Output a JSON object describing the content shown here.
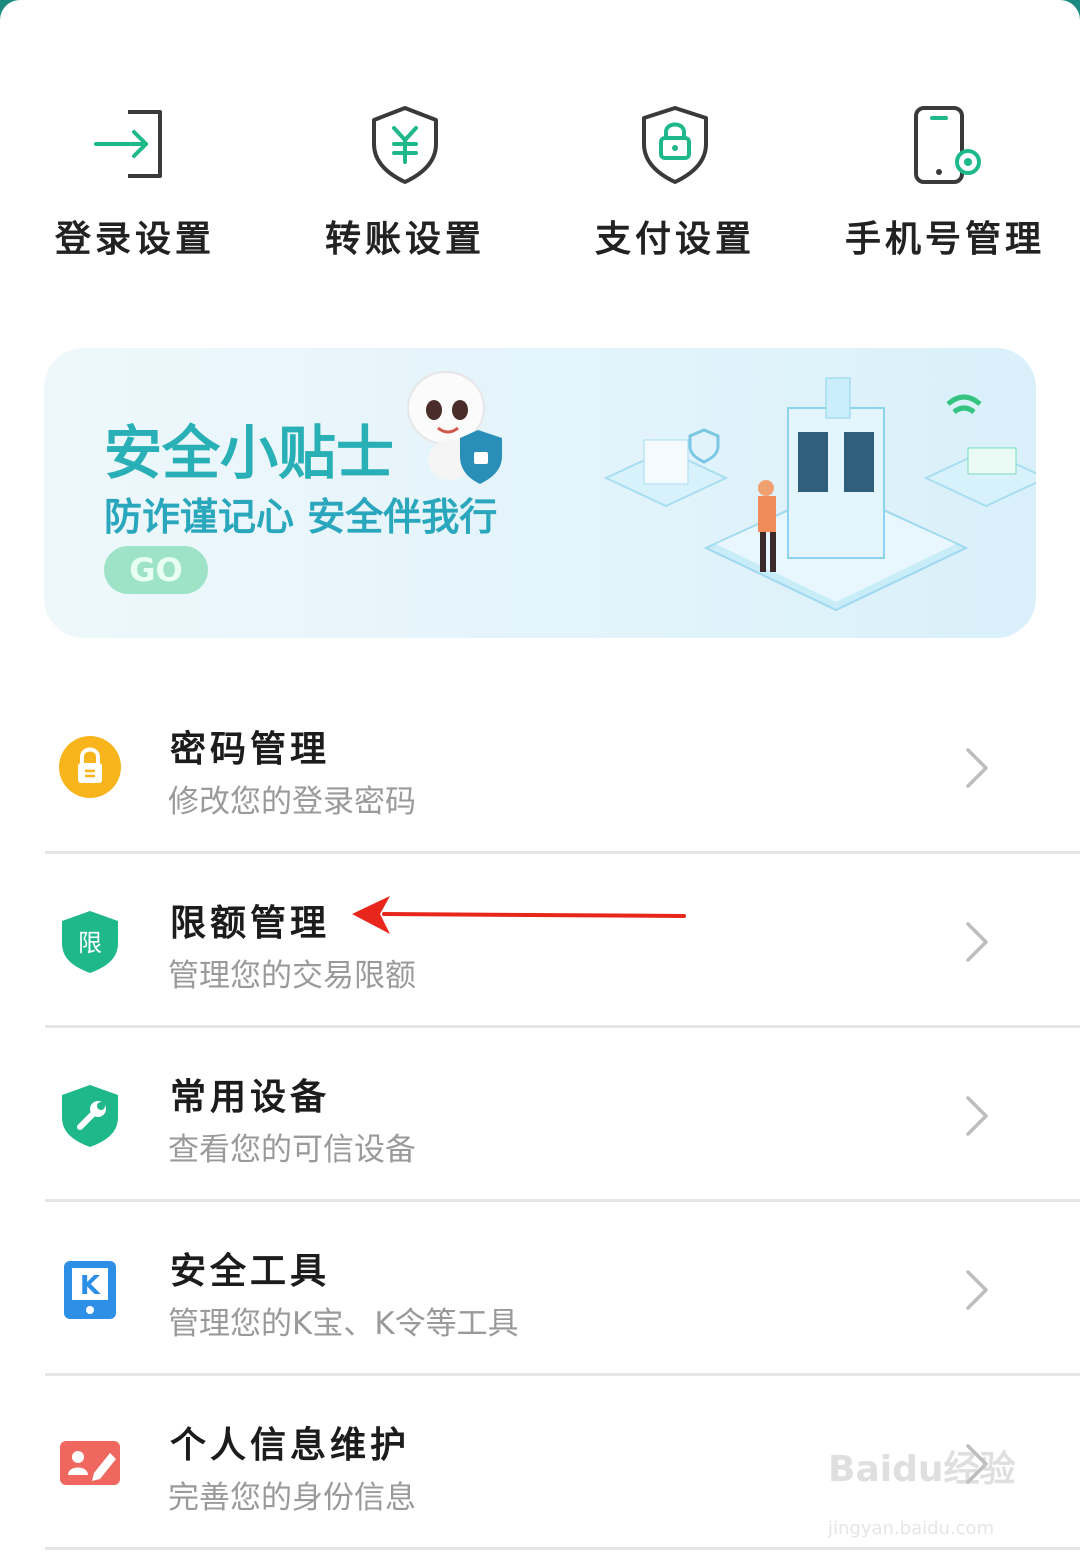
{
  "quick_actions": [
    {
      "label": "登录设置",
      "icon": "login-icon"
    },
    {
      "label": "转账设置",
      "icon": "transfer-shield-icon"
    },
    {
      "label": "支付设置",
      "icon": "payment-lock-icon"
    },
    {
      "label": "手机号管理",
      "icon": "phone-settings-icon"
    }
  ],
  "banner": {
    "title": "安全小贴士",
    "subtitle": "防诈谨记心 安全伴我行",
    "go_label": "GO"
  },
  "menu": [
    {
      "title": "密码管理",
      "subtitle": "修改您的登录密码",
      "icon": "lock-icon",
      "color": "#f7b51b"
    },
    {
      "title": "限额管理",
      "subtitle": "管理您的交易限额",
      "icon": "limit-shield-icon",
      "color": "#1fb88a",
      "icon_text": "限"
    },
    {
      "title": "常用设备",
      "subtitle": "查看您的可信设备",
      "icon": "wrench-shield-icon",
      "color": "#1fb88a"
    },
    {
      "title": "安全工具",
      "subtitle": "管理您的K宝、K令等工具",
      "icon": "k-token-icon",
      "color": "#2e8fe6",
      "icon_text": "K"
    },
    {
      "title": "个人信息维护",
      "subtitle": "完善您的身份信息",
      "icon": "id-card-edit-icon",
      "color": "#f0675f"
    }
  ],
  "watermark": {
    "text": "Baidu经验",
    "url": "jingyan.baidu.com"
  },
  "colors": {
    "accent_green": "#1fb88a",
    "banner_text": "#28b0b6",
    "subtitle_gray": "#9a9a9a",
    "annotation_red": "#e8261c"
  }
}
